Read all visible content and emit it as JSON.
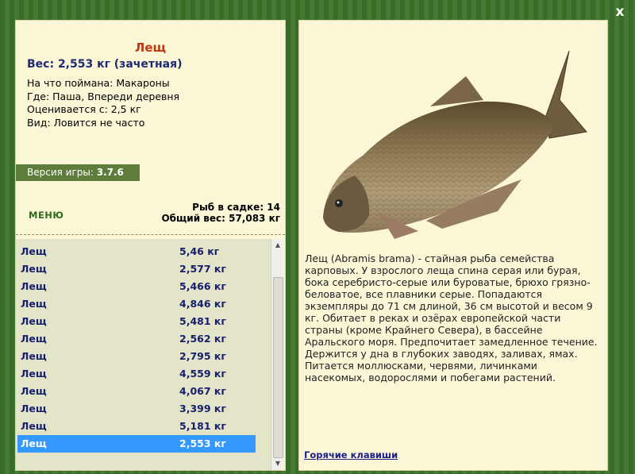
{
  "window": {
    "close_label": "x"
  },
  "fish": {
    "name": "Лещ",
    "weight_line": "Вес: 2,553 кг (зачетная)",
    "info_lines": [
      "На что поймана: Макароны",
      "Где: Паша, Впереди деревня",
      "Оценивается с: 2,5 кг",
      "Вид: Ловится не часто"
    ]
  },
  "version": {
    "label": "Версия игры:",
    "value": "3.7.6"
  },
  "menu": {
    "label": "МЕНЮ"
  },
  "stats": {
    "count_line": "Рыб в садке: 14",
    "total_line": "Общий вес: 57,083 кг"
  },
  "catch_list": [
    {
      "name": "Лещ",
      "weight": "5,46 кг"
    },
    {
      "name": "Лещ",
      "weight": "2,577 кг"
    },
    {
      "name": "Лещ",
      "weight": "5,466 кг"
    },
    {
      "name": "Лещ",
      "weight": "4,846 кг"
    },
    {
      "name": "Лещ",
      "weight": "5,481 кг"
    },
    {
      "name": "Лещ",
      "weight": "2,562 кг"
    },
    {
      "name": "Лещ",
      "weight": "2,795 кг"
    },
    {
      "name": "Лещ",
      "weight": "4,559 кг"
    },
    {
      "name": "Лещ",
      "weight": "4,067 кг"
    },
    {
      "name": "Лещ",
      "weight": "3,399 кг"
    },
    {
      "name": "Лещ",
      "weight": "5,181 кг"
    },
    {
      "name": "Лещ",
      "weight": "2,553 кг"
    }
  ],
  "description": "Лещ (Abramis brama) - стайная рыба семейства карповых. У взрослого леща спина серая или бурая, бока серебристо-серые или буроватые, брюхо грязно-беловатое, все плавники серые. Попадаются экземпляры до 71 см длиной, 36 см высотой и весом 9 кг. Обитает в реках и озёрах европейской части страны (кроме Крайнего Севера), в бассейне Аральского моря. Предпочитает замедленное течение. Держится у дна в глубоких заводях, заливах, ямах. Питается моллюсками, червями, личинками насекомых, водорослями и побегами растений.",
  "hotkeys": {
    "label": "Горячие клавиши"
  },
  "colors": {
    "background": "#3c6d2b",
    "panel": "#faf6d6",
    "fish_name": "#c0380d",
    "list_text": "#16206e",
    "selected_row": "#3399ff"
  },
  "icons": {
    "close": "close-icon",
    "scroll_up": "arrow-up-icon",
    "scroll_down": "arrow-down-icon"
  }
}
